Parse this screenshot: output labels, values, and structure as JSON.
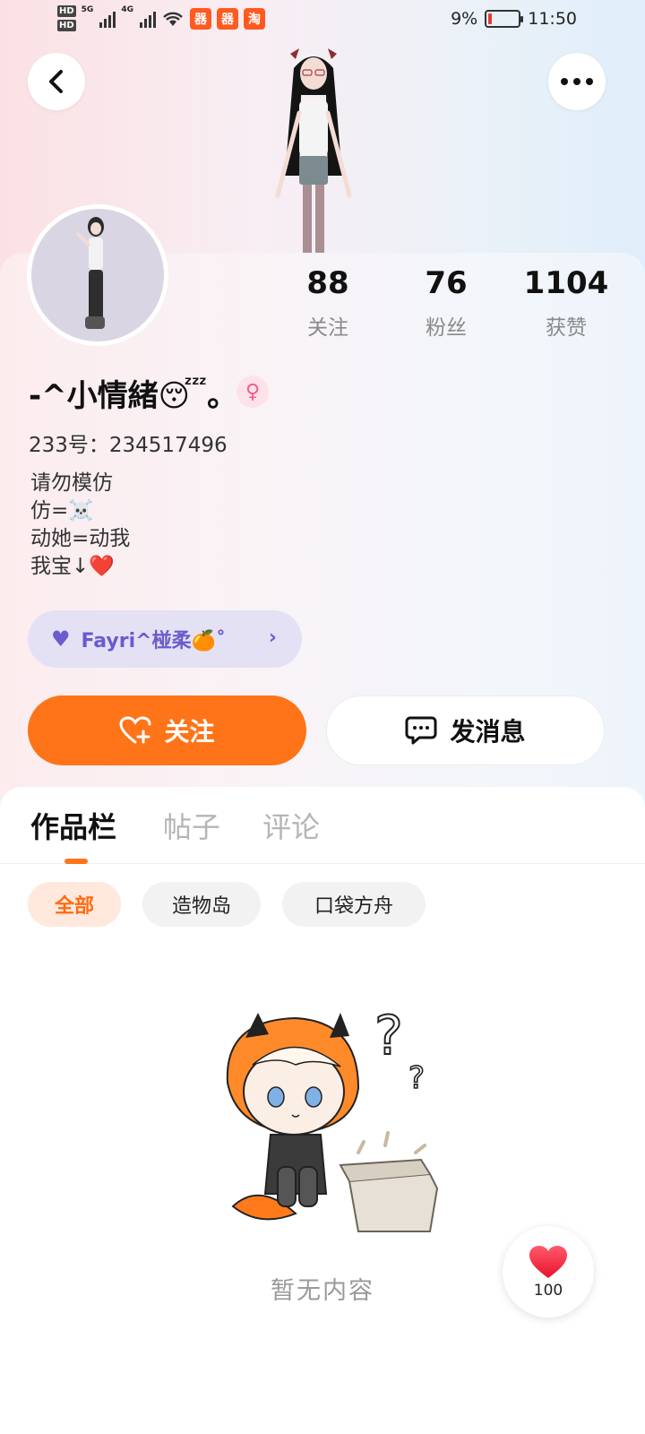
{
  "status_bar": {
    "time": "11:50",
    "battery": "9%",
    "network_1": "5G",
    "network_2": "4G",
    "hd": "HD",
    "app_badges": [
      "器",
      "器",
      "淘"
    ]
  },
  "profile": {
    "username": "-^小情緒😴。",
    "gender_symbol": "♀",
    "uid": "233号：234517496",
    "bio_lines": [
      "请勿模仿",
      "仿=☠️",
      "动她=动我",
      "我宝↓❤️"
    ],
    "fan_badge": {
      "label": "Fayri^椪柔🍊˚",
      "icon": "heart-icon"
    },
    "stats": [
      {
        "value": "88",
        "label": "关注"
      },
      {
        "value": "76",
        "label": "粉丝"
      },
      {
        "value": "1104",
        "label": "获赞"
      }
    ]
  },
  "actions": {
    "follow_label": "关注",
    "message_label": "发消息"
  },
  "tabs": [
    {
      "label": "作品栏",
      "active": true
    },
    {
      "label": "帖子",
      "active": false
    },
    {
      "label": "评论",
      "active": false
    }
  ],
  "filters": [
    {
      "label": "全部",
      "active": true
    },
    {
      "label": "造物岛",
      "active": false
    },
    {
      "label": "口袋方舟",
      "active": false
    }
  ],
  "empty_state": {
    "text": "暂无内容"
  },
  "like_fab": {
    "count": "100"
  },
  "colors": {
    "accent": "#ff7418",
    "fan_badge_bg": "#e4e1f5",
    "fan_badge_text": "#6a5ccc"
  }
}
